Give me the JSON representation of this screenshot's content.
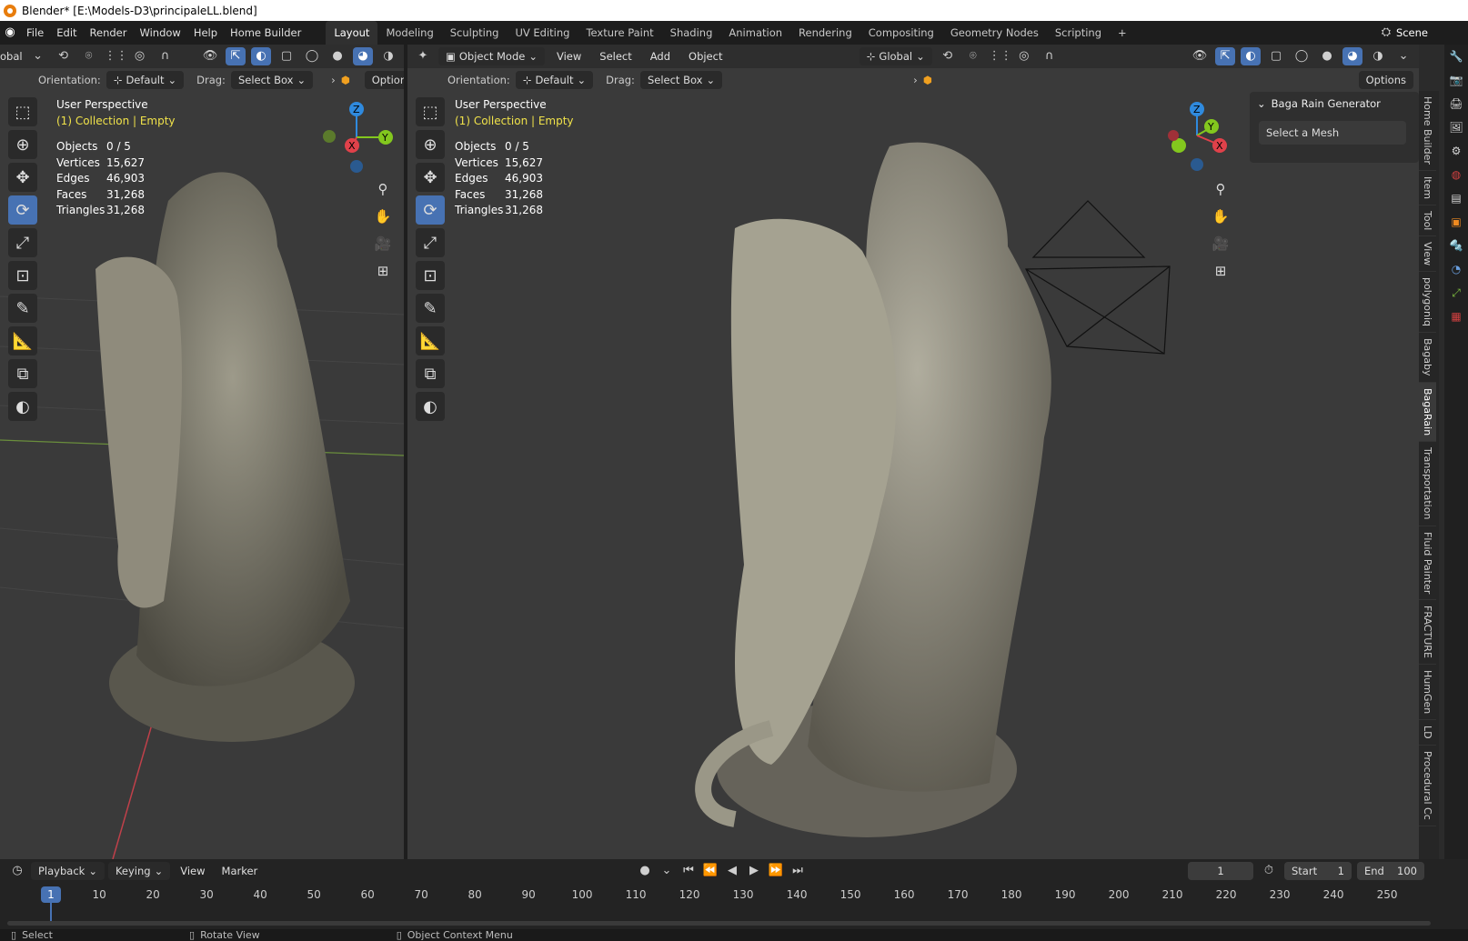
{
  "titlebar": {
    "title": "Blender* [E:\\Models-D3\\principaleLL.blend]"
  },
  "menu": {
    "items": [
      "File",
      "Edit",
      "Render",
      "Window",
      "Help",
      "Home Builder"
    ]
  },
  "workspaces": [
    "Layout",
    "Modeling",
    "Sculpting",
    "UV Editing",
    "Texture Paint",
    "Shading",
    "Animation",
    "Rendering",
    "Compositing",
    "Geometry Nodes",
    "Scripting"
  ],
  "scene": {
    "label": "Scene"
  },
  "left_viewport": {
    "orient_cut": "obal",
    "orientation_label": "Orientation:",
    "orientation_value": "Default",
    "drag_label": "Drag:",
    "drag_value": "Select Box",
    "options": "Options",
    "perspective": "User Perspective",
    "collection": "(1) Collection | Empty",
    "stats": [
      {
        "k": "Objects",
        "v": "0 / 5"
      },
      {
        "k": "Vertices",
        "v": "15,627"
      },
      {
        "k": "Edges",
        "v": "46,903"
      },
      {
        "k": "Faces",
        "v": "31,268"
      },
      {
        "k": "Triangles",
        "v": "31,268"
      }
    ]
  },
  "right_viewport": {
    "mode": "Object Mode",
    "menus": [
      "View",
      "Select",
      "Add",
      "Object"
    ],
    "transform_orient": "Global",
    "orientation_label": "Orientation:",
    "orientation_value": "Default",
    "drag_label": "Drag:",
    "drag_value": "Select Box",
    "options": "Options",
    "perspective": "User Perspective",
    "collection": "(1) Collection | Empty",
    "stats": [
      {
        "k": "Objects",
        "v": "0 / 5"
      },
      {
        "k": "Vertices",
        "v": "15,627"
      },
      {
        "k": "Edges",
        "v": "46,903"
      },
      {
        "k": "Faces",
        "v": "31,268"
      },
      {
        "k": "Triangles",
        "v": "31,268"
      }
    ]
  },
  "gizmo": {
    "z": "Z",
    "y": "Y",
    "x": "X"
  },
  "npanel": {
    "title": "Baga Rain Generator",
    "button": "Select a Mesh",
    "tabs": [
      "Home Builder",
      "Item",
      "Tool",
      "View",
      "polygoniq",
      "Bagaby",
      "BagaRain",
      "Transportation",
      "Fluid Painter",
      "FRACTURE",
      "HumGen",
      "LD",
      "Procedural Cc"
    ],
    "active_tab": "BagaRain"
  },
  "timeline": {
    "menus": [
      "Playback",
      "Keying",
      "View",
      "Marker"
    ],
    "current_frame": "1",
    "start_label": "Start",
    "start": "1",
    "end_label": "End",
    "end": "100",
    "ticks": [
      "1",
      "10",
      "20",
      "30",
      "40",
      "50",
      "60",
      "70",
      "80",
      "90",
      "100",
      "110",
      "120",
      "130",
      "140",
      "150",
      "160",
      "170",
      "180",
      "190",
      "200",
      "210",
      "220",
      "230",
      "240",
      "250"
    ]
  },
  "statusbar": {
    "items": [
      "Select",
      "Rotate View",
      "Object Context Menu"
    ]
  },
  "colors": {
    "accent": "#4772b3",
    "axis_x": "#e0414a",
    "axis_y": "#83c71e",
    "axis_z": "#2f8ade",
    "text_yellow": "#f0e24a"
  }
}
